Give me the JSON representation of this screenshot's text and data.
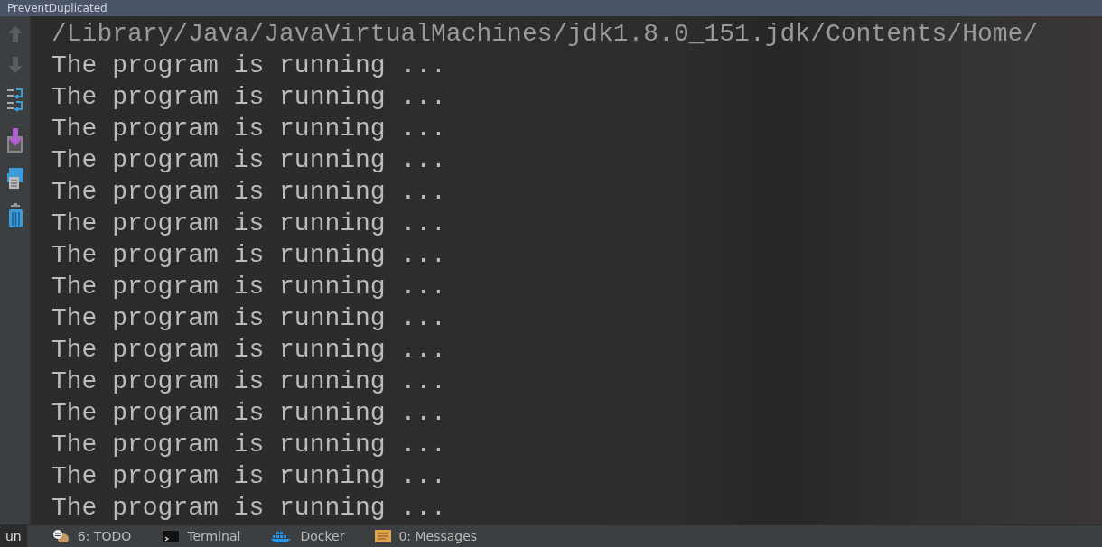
{
  "window": {
    "title": "PreventDuplicated"
  },
  "console": {
    "lines": [
      "/Library/Java/JavaVirtualMachines/jdk1.8.0_151.jdk/Contents/Home/",
      "The program is running ...",
      "The program is running ...",
      "The program is running ...",
      "The program is running ...",
      "The program is running ...",
      "The program is running ...",
      "The program is running ...",
      "The program is running ...",
      "The program is running ...",
      "The program is running ...",
      "The program is running ...",
      "The program is running ...",
      "The program is running ...",
      "The program is running ...",
      "The program is running ..."
    ]
  },
  "tool_tabs": [
    {
      "label": "un",
      "selected": true
    },
    {
      "label": "6: TODO",
      "selected": false
    },
    {
      "label": "Terminal",
      "selected": false
    },
    {
      "label": "Docker",
      "selected": false
    },
    {
      "label": "0: Messages",
      "selected": false
    }
  ]
}
